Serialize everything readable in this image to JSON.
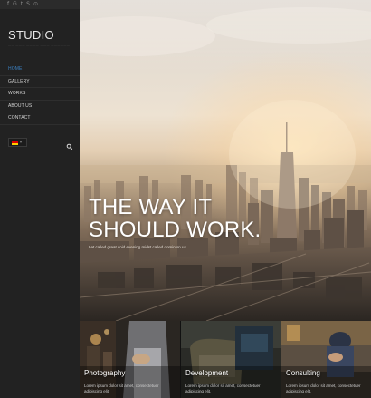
{
  "social": {
    "icons": [
      {
        "name": "facebook-icon",
        "glyph": "f"
      },
      {
        "name": "google-plus-icon",
        "glyph": "G"
      },
      {
        "name": "twitter-icon",
        "glyph": "t"
      },
      {
        "name": "skype-icon",
        "glyph": "S"
      },
      {
        "name": "github-icon",
        "glyph": "⊙"
      }
    ]
  },
  "brand": {
    "name": "STUDIO",
    "tagline": "—— ——— ———— ——— ——————"
  },
  "menu": {
    "items": [
      {
        "label": "Home",
        "active": true
      },
      {
        "label": "Gallery",
        "active": false
      },
      {
        "label": "Works",
        "active": false
      },
      {
        "label": "About us",
        "active": false
      },
      {
        "label": "Contact",
        "active": false
      }
    ]
  },
  "language": {
    "selected": "German",
    "flag_colors": [
      "#000000",
      "#dd0000",
      "#ffce00"
    ]
  },
  "search": {
    "icon": "search-icon"
  },
  "hero": {
    "title_line1": "THE WAY IT",
    "title_line2": "SHOULD WORK.",
    "subtitle": "Let called great void evening midst called dominion us."
  },
  "cards": [
    {
      "title": "Photography",
      "text": "Lorem ipsum dolor sit amet, consectetuer adipiscing elit."
    },
    {
      "title": "Development",
      "text": "Lorem ipsum dolor sit amet, consectetuer adipiscing elit."
    },
    {
      "title": "Consulting",
      "text": "Lorem ipsum dolor sit amet, consectetuer adipiscing elit."
    }
  ],
  "colors": {
    "sidebar_bg": "#222222",
    "active_link": "#3b82c4",
    "text": "#d4d4d4"
  }
}
